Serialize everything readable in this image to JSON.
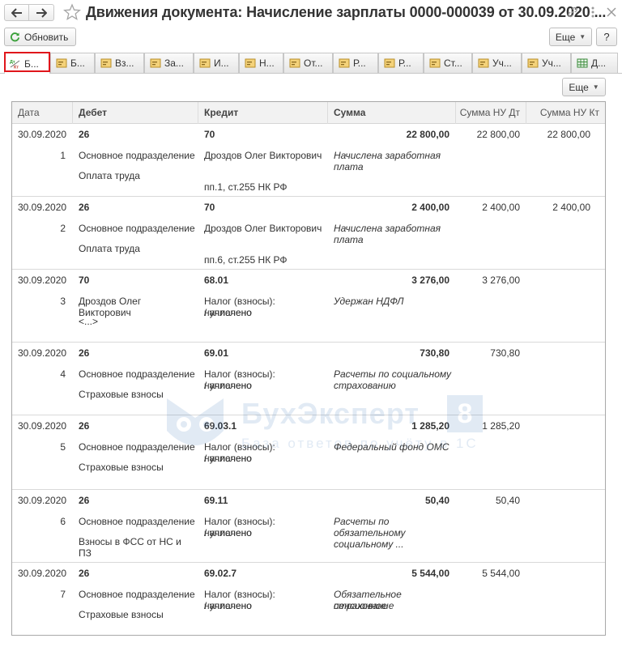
{
  "window": {
    "title": "Движения документа: Начисление зарплаты 0000-000039 от 30.09.2020 ..."
  },
  "toolbar": {
    "refresh_label": "Обновить",
    "more_label": "Еще",
    "help_label": "?"
  },
  "tabs": [
    {
      "label": "Б...",
      "icon": "dt-kt-icon",
      "active": true
    },
    {
      "label": "Б...",
      "icon": "register-icon"
    },
    {
      "label": "Вз...",
      "icon": "register-icon"
    },
    {
      "label": "За...",
      "icon": "register-icon"
    },
    {
      "label": "И...",
      "icon": "register-icon"
    },
    {
      "label": "Н...",
      "icon": "register-icon"
    },
    {
      "label": "От...",
      "icon": "register-icon"
    },
    {
      "label": "Р...",
      "icon": "register-icon"
    },
    {
      "label": "Р...",
      "icon": "register-icon"
    },
    {
      "label": "Ст...",
      "icon": "register-icon"
    },
    {
      "label": "Уч...",
      "icon": "register-icon"
    },
    {
      "label": "Уч...",
      "icon": "register-icon"
    },
    {
      "label": "Д...",
      "icon": "table-icon"
    }
  ],
  "panel": {
    "more_label": "Еще"
  },
  "grid": {
    "columns": [
      "Дата",
      "Дебет",
      "Кредит",
      "Сумма",
      "Сумма НУ Дт",
      "Сумма НУ Кт"
    ],
    "rows": [
      {
        "date": "30.09.2020",
        "num": "1",
        "debit": [
          "26",
          "Основное подразделение",
          "Оплата труда"
        ],
        "credit": [
          "70",
          "Дроздов Олег Викторович",
          "",
          "пп.1, ст.255 НК РФ"
        ],
        "sum": "22 800,00",
        "desc": [
          "Начислена заработная",
          "плата"
        ],
        "nu_dt": "22 800,00",
        "nu_kt": "22 800,00"
      },
      {
        "date": "30.09.2020",
        "num": "2",
        "debit": [
          "26",
          "Основное подразделение",
          "Оплата труда"
        ],
        "credit": [
          "70",
          "Дроздов Олег Викторович",
          "",
          "пп.6, ст.255 НК РФ"
        ],
        "sum": "2 400,00",
        "desc": [
          "Начислена заработная",
          "плата"
        ],
        "nu_dt": "2 400,00",
        "nu_kt": "2 400,00"
      },
      {
        "date": "30.09.2020",
        "num": "3",
        "debit": [
          "70",
          "Дроздов Олег Викторович",
          "<...>"
        ],
        "credit": [
          "68.01",
          "Налог (взносы): начислено",
          "/ уплачено",
          ""
        ],
        "sum": "3 276,00",
        "desc": [
          "Удержан НДФЛ",
          ""
        ],
        "nu_dt": "3 276,00",
        "nu_kt": ""
      },
      {
        "date": "30.09.2020",
        "num": "4",
        "debit": [
          "26",
          "Основное подразделение",
          "Страховые взносы"
        ],
        "credit": [
          "69.01",
          "Налог (взносы): начислено",
          "/ уплачено",
          ""
        ],
        "sum": "730,80",
        "desc": [
          "Расчеты по социальному",
          "страхованию"
        ],
        "nu_dt": "730,80",
        "nu_kt": ""
      },
      {
        "date": "30.09.2020",
        "num": "5",
        "debit": [
          "26",
          "Основное подразделение",
          "Страховые взносы"
        ],
        "credit": [
          "69.03.1",
          "Налог (взносы): начислено",
          "/ уплачено",
          ""
        ],
        "sum": "1 285,20",
        "desc": [
          "Федеральный фонд ОМС",
          ""
        ],
        "nu_dt": "1 285,20",
        "nu_kt": ""
      },
      {
        "date": "30.09.2020",
        "num": "6",
        "debit": [
          "26",
          "Основное подразделение",
          "Взносы в ФСС от НС и ПЗ"
        ],
        "credit": [
          "69.11",
          "Налог (взносы): начислено",
          "/ уплачено",
          ""
        ],
        "sum": "50,40",
        "desc": [
          "Расчеты по",
          "обязательному",
          "социальному ..."
        ],
        "nu_dt": "50,40",
        "nu_kt": ""
      },
      {
        "date": "30.09.2020",
        "num": "7",
        "debit": [
          "26",
          "Основное подразделение",
          "Страховые взносы"
        ],
        "credit": [
          "69.02.7",
          "Налог (взносы): начислено",
          "/ уплачено",
          ""
        ],
        "sum": "5 544,00",
        "desc": [
          "Обязательное пенсионное",
          "страхование"
        ],
        "nu_dt": "5 544,00",
        "nu_kt": ""
      }
    ]
  },
  "watermark": {
    "brand": "БухЭксперт",
    "badge": "8",
    "subtitle": "База ответов по учёту в 1С"
  }
}
